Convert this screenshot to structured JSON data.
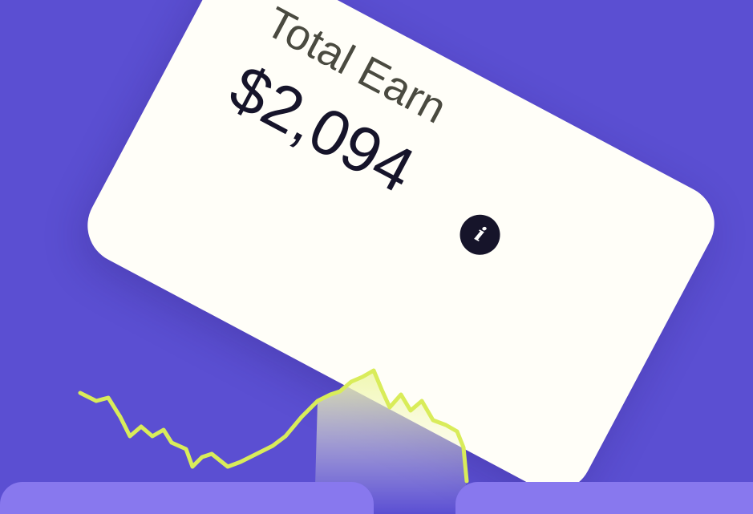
{
  "card": {
    "title": "Total Earn",
    "amount": "$2,094",
    "info_icon_glyph": "i"
  },
  "colors": {
    "background": "#5b4fd2",
    "card": "#fffef8",
    "sparkline": "#d9ec5a",
    "bottom_panels": "#8878ee",
    "amount_text": "#16142a"
  },
  "icons": [
    "info-icon"
  ]
}
